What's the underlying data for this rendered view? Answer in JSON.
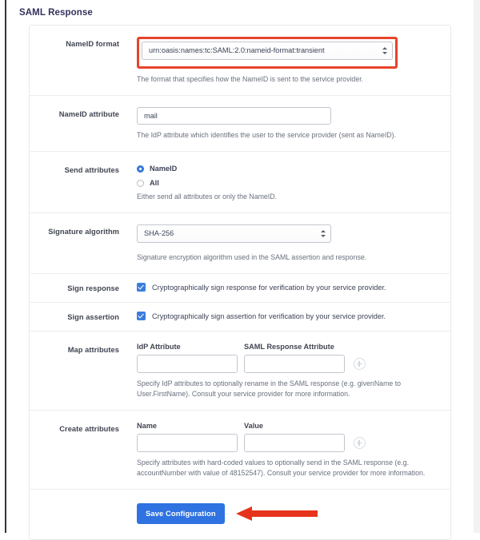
{
  "section": {
    "title": "SAML Response"
  },
  "rows": {
    "nameid_format": {
      "label": "NameID format",
      "value": "urn:oasis:names:tc:SAML:2.0:nameid-format:transient",
      "help": "The format that specifies how the NameID is sent to the service provider.",
      "highlight_color": "#e8432b"
    },
    "nameid_attribute": {
      "label": "NameID attribute",
      "value": "mail",
      "help": "The IdP attribute which identifies the user to the service provider (sent as NameID)."
    },
    "send_attributes": {
      "label": "Send attributes",
      "options": [
        {
          "label": "NameID",
          "selected": true
        },
        {
          "label": "All",
          "selected": false
        }
      ],
      "help": "Either send all attributes or only the NameID."
    },
    "signature_algorithm": {
      "label": "Signature algorithm",
      "value": "SHA-256",
      "help": "Signature encryption algorithm used in the SAML assertion and response."
    },
    "sign_response": {
      "label": "Sign response",
      "checked": true,
      "text": "Cryptographically sign response for verification by your service provider."
    },
    "sign_assertion": {
      "label": "Sign assertion",
      "checked": true,
      "text": "Cryptographically sign assertion for verification by your service provider."
    },
    "map_attributes": {
      "label": "Map attributes",
      "columns": [
        "IdP Attribute",
        "SAML Response Attribute"
      ],
      "values": [
        "",
        ""
      ],
      "add_icon": "plus-circle-icon",
      "help": "Specify IdP attributes to optionally rename in the SAML response (e.g. givenName to User.FirstName). Consult your service provider for more information."
    },
    "create_attributes": {
      "label": "Create attributes",
      "columns": [
        "Name",
        "Value"
      ],
      "values": [
        "",
        ""
      ],
      "add_icon": "plus-circle-icon",
      "help": "Specify attributes with hard-coded values to optionally send in the SAML response (e.g. accountNumber with value of 48152547). Consult your service provider for more information."
    }
  },
  "footer": {
    "save_label": "Save Configuration",
    "save_color": "#2f72e1",
    "annotation_arrow_color": "#e8331c"
  }
}
